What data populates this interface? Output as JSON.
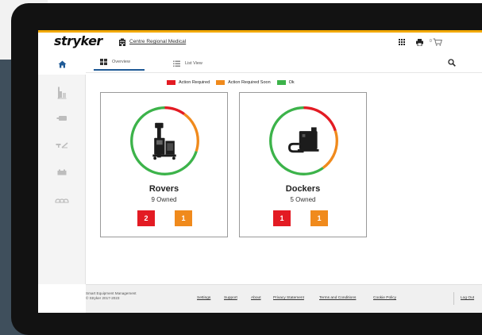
{
  "header": {
    "logo_text": "stryker",
    "facility_name": "Centre Regional Medical",
    "cart_count": "0",
    "accent_color": "#f2a900"
  },
  "icons": {
    "facility": "building-icon",
    "apps": "grid-icon",
    "print": "printer-icon",
    "cart": "cart-icon",
    "search": "search-icon"
  },
  "sidebar": {
    "items": [
      {
        "name": "home",
        "icon": "home-icon",
        "active": true
      },
      {
        "name": "rovers",
        "icon": "rover-icon",
        "active": false
      },
      {
        "name": "battery",
        "icon": "battery-icon",
        "active": false
      },
      {
        "name": "tools",
        "icon": "tools-icon",
        "active": false
      },
      {
        "name": "charger",
        "icon": "charger-icon",
        "active": false
      },
      {
        "name": "connectors",
        "icon": "connector-icon",
        "active": false
      }
    ]
  },
  "tabs": [
    {
      "label": "Overview",
      "icon": "overview-icon",
      "active": true
    },
    {
      "label": "List View",
      "icon": "list-icon",
      "active": false
    }
  ],
  "legend": [
    {
      "label": "Action Required",
      "color": "#e31b23"
    },
    {
      "label": "Action Required Soon",
      "color": "#f08a1c"
    },
    {
      "label": "Ok",
      "color": "#3cb34a"
    }
  ],
  "cards": [
    {
      "title": "Rovers",
      "owned": "9 Owned",
      "icon": "rover-device-icon",
      "action_required": "2",
      "action_required_soon": "1"
    },
    {
      "title": "Dockers",
      "owned": "5 Owned",
      "icon": "docker-device-icon",
      "action_required": "1",
      "action_required_soon": "1"
    }
  ],
  "footer": {
    "app_name": "Smart Equipment Management",
    "copyright": "© Stryker 2017-2023",
    "links": [
      "Settings",
      "Support",
      "About",
      "Privacy Statement",
      "Terms and Conditions",
      "Cookie Policy"
    ],
    "logout": "Log Out"
  }
}
